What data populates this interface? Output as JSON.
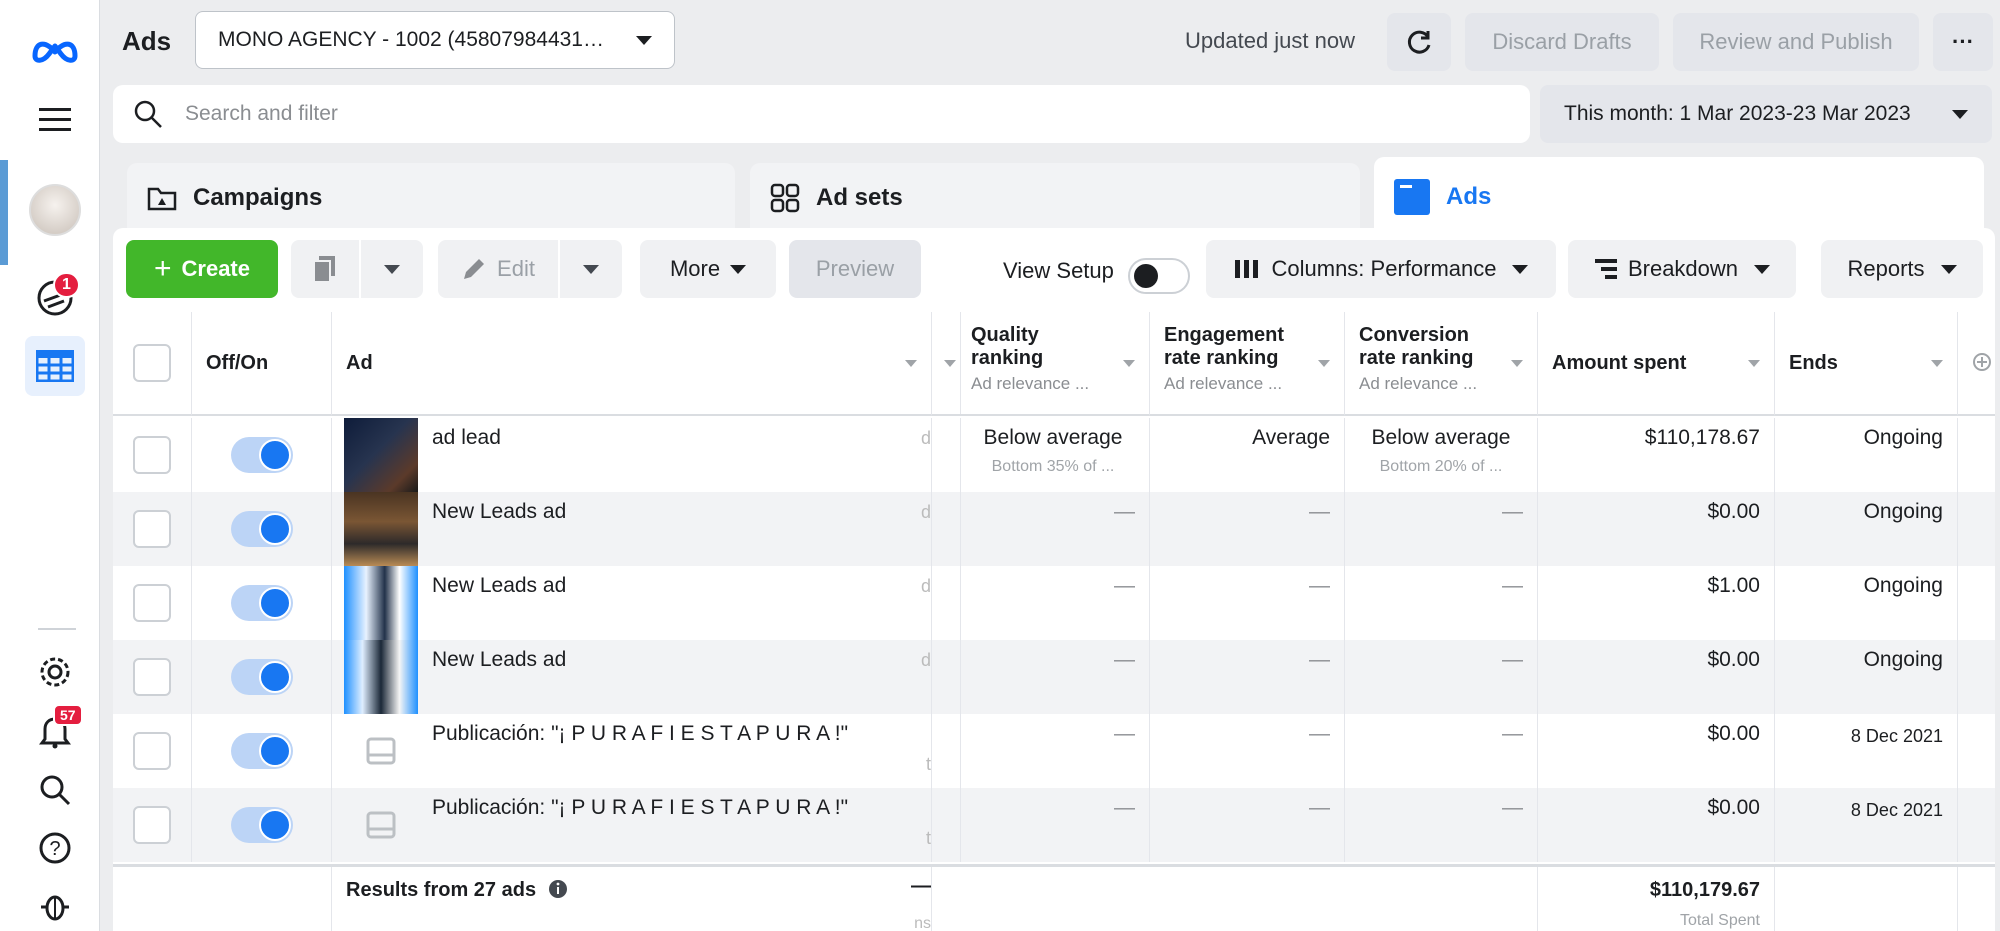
{
  "topbar": {
    "title": "Ads",
    "account": "MONO AGENCY - 1002 (45807984431…",
    "updated": "Updated just now",
    "discard": "Discard Drafts",
    "review": "Review and Publish",
    "more": "···"
  },
  "rail": {
    "notif_badge": "1",
    "alerts_badge": "57"
  },
  "search": {
    "placeholder": "Search and filter"
  },
  "date_range": "This month: 1 Mar 2023-23 Mar 2023",
  "tabs": {
    "campaigns": "Campaigns",
    "adsets": "Ad sets",
    "ads": "Ads"
  },
  "toolbar": {
    "create": "Create",
    "edit": "Edit",
    "more": "More",
    "preview": "Preview",
    "view_setup": "View Setup",
    "columns": "Columns: Performance",
    "breakdown": "Breakdown",
    "reports": "Reports"
  },
  "columns": {
    "offon": "Off/On",
    "ad": "Ad",
    "quality": "Quality ranking",
    "quality_sub": "Ad relevance ...",
    "engagement": "Engagement rate ranking",
    "engagement_sub": "Ad relevance ...",
    "conversion": "Conversion rate ranking",
    "conversion_sub": "Ad relevance ...",
    "amount": "Amount spent",
    "ends": "Ends"
  },
  "rows": [
    {
      "name": "ad lead",
      "quality": "Below average",
      "quality_sub": "Bottom 35% of ...",
      "engagement": "Average",
      "conversion": "Below average",
      "conversion_sub": "Bottom 20% of ...",
      "amount": "$110,178.67",
      "ends": "Ongoing",
      "edge": "d"
    },
    {
      "name": "New Leads ad",
      "quality": "—",
      "engagement": "—",
      "conversion": "—",
      "amount": "$0.00",
      "ends": "Ongoing",
      "edge": "d"
    },
    {
      "name": "New Leads ad",
      "quality": "—",
      "engagement": "—",
      "conversion": "—",
      "amount": "$1.00",
      "ends": "Ongoing",
      "edge": "d"
    },
    {
      "name": "New Leads ad",
      "quality": "—",
      "engagement": "—",
      "conversion": "—",
      "amount": "$0.00",
      "ends": "Ongoing",
      "edge": "d"
    },
    {
      "name": "Publicación: \"¡ P U R A F I E S T A P U R A !\"",
      "quality": "—",
      "engagement": "—",
      "conversion": "—",
      "amount": "$0.00",
      "ends": "8 Dec 2021",
      "edge": "t"
    },
    {
      "name": "Publicación: \"¡ P U R A F I E S T A P U R A !\"",
      "quality": "—",
      "engagement": "—",
      "conversion": "—",
      "amount": "$0.00",
      "ends": "8 Dec 2021",
      "edge": "t"
    }
  ],
  "footer": {
    "results": "Results from 27 ads",
    "total": "$110,179.67",
    "total_label": "Total Spent",
    "edge": "—",
    "edge_sub": "ns"
  },
  "colors": {
    "brand_blue": "#1877f2",
    "create_green": "#42b72a",
    "badge_red": "#e41e3f"
  }
}
